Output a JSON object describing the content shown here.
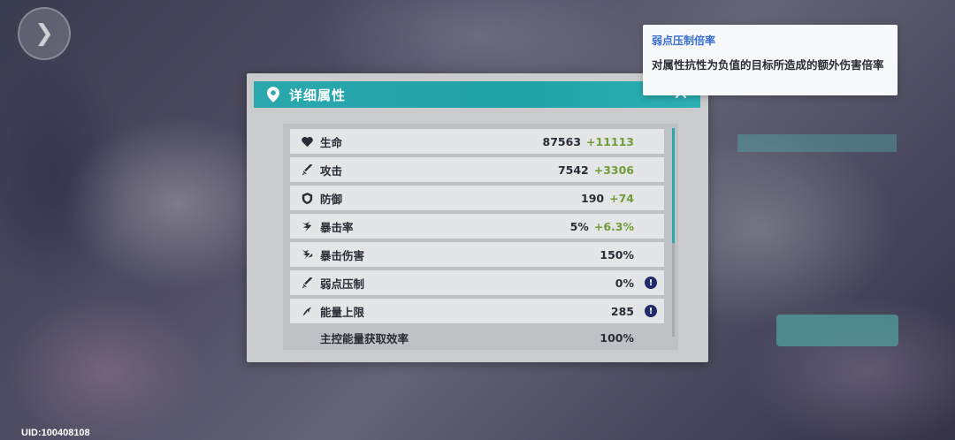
{
  "panel": {
    "title": "详细属性",
    "close_icon": "close-icon",
    "accent_color": "#2aa8ad"
  },
  "stats": [
    {
      "icon": "heart-icon",
      "name": "生命",
      "value": "87563",
      "bonus": "+11113",
      "info": false
    },
    {
      "icon": "sword-icon",
      "name": "攻击",
      "value": "7542",
      "bonus": "+3306",
      "info": false
    },
    {
      "icon": "shield-icon",
      "name": "防御",
      "value": "190",
      "bonus": "+74",
      "info": false
    },
    {
      "icon": "crit-rate-icon",
      "name": "暴击率",
      "value": "5%",
      "bonus": "+6.3%",
      "info": false
    },
    {
      "icon": "crit-damage-icon",
      "name": "暴击伤害",
      "value": "150%",
      "bonus": "",
      "info": false
    },
    {
      "icon": "weakness-icon",
      "name": "弱点压制",
      "value": "0%",
      "bonus": "",
      "info": true
    },
    {
      "icon": "energy-icon",
      "name": "能量上限",
      "value": "285",
      "bonus": "",
      "info": true
    },
    {
      "icon": "",
      "name": "主控能量获取效率",
      "value": "100%",
      "bonus": "",
      "info": false
    }
  ],
  "tooltip": {
    "title": "弱点压制倍率",
    "body": "对属性抗性为负值的目标所造成的额外伤害倍率"
  },
  "footer": {
    "uid": "UID:100408108"
  },
  "colors": {
    "bonus": "#6f9d3a",
    "tooltip_title": "#3a6fd0",
    "info_badge": "#1e2c6b"
  }
}
